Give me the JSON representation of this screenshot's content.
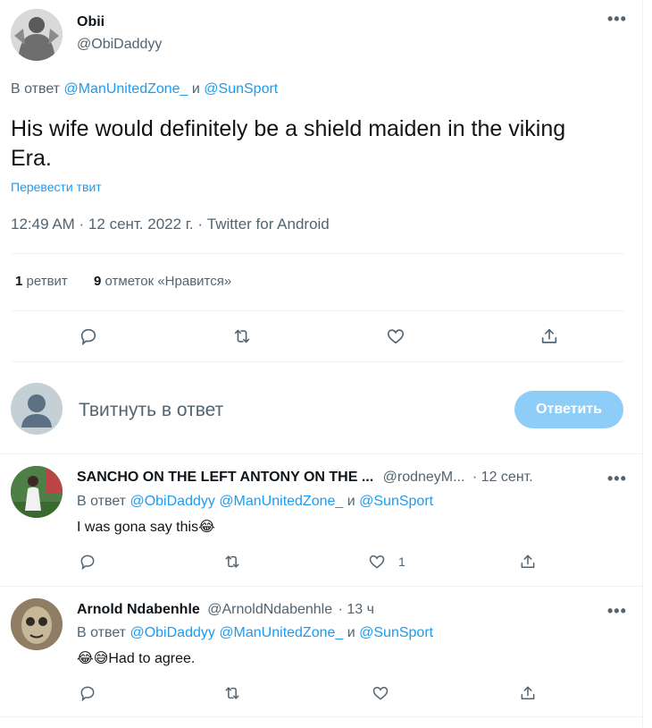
{
  "tweet": {
    "author_name": "Obii",
    "author_handle": "@ObiDaddyy",
    "reply_prefix": "В ответ",
    "reply_mention_1": "@ManUnitedZone_",
    "reply_and": "и",
    "reply_mention_2": "@SunSport",
    "text": "His wife would definitely be a shield maiden in the viking Era.",
    "translate": "Перевести твит",
    "timestamp": "12:49 AM · 12 сент. 2022 г. · Twitter for Android",
    "retweet_count": "1",
    "retweet_label": "ретвит",
    "like_count": "9",
    "like_label": "отметок «Нравится»"
  },
  "composer": {
    "placeholder": "Твитнуть в ответ",
    "button_label": "Ответить"
  },
  "replies": [
    {
      "author_name": "SANCHO ON THE LEFT ANTONY ON THE ...",
      "author_handle": "@rodneyM...",
      "time": "· 12 сент.",
      "reply_prefix": "В ответ",
      "mention_1": "@ObiDaddyy",
      "mention_2": "@ManUnitedZone_",
      "and": "и",
      "mention_3": "@SunSport",
      "text": "I was gona say this",
      "emoji": "😂",
      "like_count": "1"
    },
    {
      "author_name": "Arnold Ndabenhle",
      "author_handle": "@ArnoldNdabenhle",
      "time": "· 13 ч",
      "reply_prefix": "В ответ",
      "mention_1": "@ObiDaddyy",
      "mention_2": "@ManUnitedZone_",
      "and": "и",
      "mention_3": "@SunSport",
      "emoji": "😂😅",
      "text": "Had to agree.",
      "like_count": ""
    }
  ],
  "icons": {
    "more": "more-icon",
    "reply": "reply-icon",
    "retweet": "retweet-icon",
    "like": "like-icon",
    "share": "share-icon"
  },
  "colors": {
    "accent": "#1d9bf0",
    "button_disabled": "#8ecdf8",
    "muted": "#536471",
    "divider": "#eff3f4"
  }
}
